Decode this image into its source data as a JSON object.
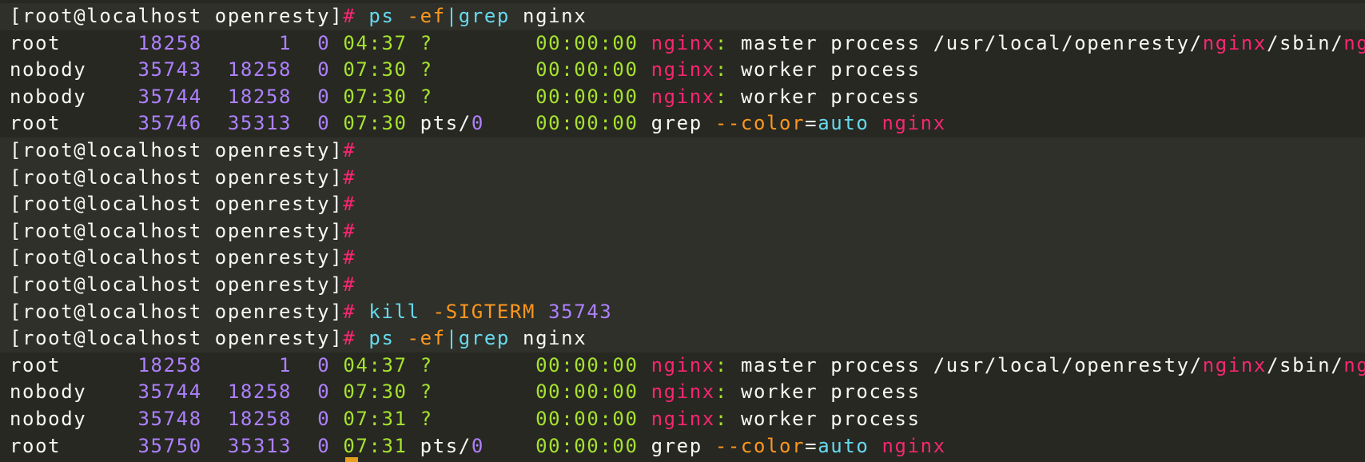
{
  "colors": {
    "background": "#272822",
    "highlight_background": "#2f3029",
    "default": "#f8f8f2",
    "prompt_hash": "#f92672",
    "command": "#66d9ef",
    "option": "#fd971f",
    "number": "#ae81ff",
    "time": "#a6e22e",
    "keyword": "#f92672",
    "value": "#66d9ef"
  },
  "terminal": {
    "lines": [
      {
        "hl": true,
        "segs": [
          {
            "t": "[root@localhost openresty]",
            "c": "default"
          },
          {
            "t": "# ",
            "c": "prompt_hash"
          },
          {
            "t": "ps ",
            "c": "command"
          },
          {
            "t": "-ef",
            "c": "option"
          },
          {
            "t": "|",
            "c": "command"
          },
          {
            "t": "grep ",
            "c": "command"
          },
          {
            "t": "nginx",
            "c": "default"
          }
        ]
      },
      {
        "hl": false,
        "segs": [
          {
            "t": "root      ",
            "c": "default"
          },
          {
            "t": "18258",
            "c": "number"
          },
          {
            "t": "      ",
            "c": "default"
          },
          {
            "t": "1",
            "c": "number"
          },
          {
            "t": "  ",
            "c": "default"
          },
          {
            "t": "0",
            "c": "number"
          },
          {
            "t": " ",
            "c": "default"
          },
          {
            "t": "04:37",
            "c": "time"
          },
          {
            "t": " ",
            "c": "default"
          },
          {
            "t": "?",
            "c": "time"
          },
          {
            "t": "        ",
            "c": "default"
          },
          {
            "t": "00:00:00",
            "c": "time"
          },
          {
            "t": " ",
            "c": "default"
          },
          {
            "t": "nginx",
            "c": "keyword"
          },
          {
            "t": ":",
            "c": "time"
          },
          {
            "t": " master process /usr/local/openresty/",
            "c": "default"
          },
          {
            "t": "nginx",
            "c": "keyword"
          },
          {
            "t": "/sbin/",
            "c": "default"
          },
          {
            "t": "nginx",
            "c": "keyword"
          }
        ]
      },
      {
        "hl": false,
        "segs": [
          {
            "t": "nobody    ",
            "c": "default"
          },
          {
            "t": "35743",
            "c": "number"
          },
          {
            "t": "  ",
            "c": "default"
          },
          {
            "t": "18258",
            "c": "number"
          },
          {
            "t": "  ",
            "c": "default"
          },
          {
            "t": "0",
            "c": "number"
          },
          {
            "t": " ",
            "c": "default"
          },
          {
            "t": "07:30",
            "c": "time"
          },
          {
            "t": " ",
            "c": "default"
          },
          {
            "t": "?",
            "c": "time"
          },
          {
            "t": "        ",
            "c": "default"
          },
          {
            "t": "00:00:00",
            "c": "time"
          },
          {
            "t": " ",
            "c": "default"
          },
          {
            "t": "nginx",
            "c": "keyword"
          },
          {
            "t": ":",
            "c": "time"
          },
          {
            "t": " worker process",
            "c": "default"
          }
        ]
      },
      {
        "hl": false,
        "segs": [
          {
            "t": "nobody    ",
            "c": "default"
          },
          {
            "t": "35744",
            "c": "number"
          },
          {
            "t": "  ",
            "c": "default"
          },
          {
            "t": "18258",
            "c": "number"
          },
          {
            "t": "  ",
            "c": "default"
          },
          {
            "t": "0",
            "c": "number"
          },
          {
            "t": " ",
            "c": "default"
          },
          {
            "t": "07:30",
            "c": "time"
          },
          {
            "t": " ",
            "c": "default"
          },
          {
            "t": "?",
            "c": "time"
          },
          {
            "t": "        ",
            "c": "default"
          },
          {
            "t": "00:00:00",
            "c": "time"
          },
          {
            "t": " ",
            "c": "default"
          },
          {
            "t": "nginx",
            "c": "keyword"
          },
          {
            "t": ":",
            "c": "time"
          },
          {
            "t": " worker process",
            "c": "default"
          }
        ]
      },
      {
        "hl": false,
        "segs": [
          {
            "t": "root      ",
            "c": "default"
          },
          {
            "t": "35746",
            "c": "number"
          },
          {
            "t": "  ",
            "c": "default"
          },
          {
            "t": "35313",
            "c": "number"
          },
          {
            "t": "  ",
            "c": "default"
          },
          {
            "t": "0",
            "c": "number"
          },
          {
            "t": " ",
            "c": "default"
          },
          {
            "t": "07:30",
            "c": "time"
          },
          {
            "t": " pts/",
            "c": "default"
          },
          {
            "t": "0",
            "c": "number"
          },
          {
            "t": "    ",
            "c": "default"
          },
          {
            "t": "00:00:00",
            "c": "time"
          },
          {
            "t": " grep ",
            "c": "default"
          },
          {
            "t": "--color",
            "c": "option"
          },
          {
            "t": "=",
            "c": "default"
          },
          {
            "t": "auto",
            "c": "value"
          },
          {
            "t": " ",
            "c": "default"
          },
          {
            "t": "nginx",
            "c": "keyword"
          }
        ]
      },
      {
        "hl": true,
        "segs": [
          {
            "t": "[root@localhost openresty]",
            "c": "default"
          },
          {
            "t": "#",
            "c": "prompt_hash"
          }
        ]
      },
      {
        "hl": true,
        "segs": [
          {
            "t": "[root@localhost openresty]",
            "c": "default"
          },
          {
            "t": "#",
            "c": "prompt_hash"
          }
        ]
      },
      {
        "hl": true,
        "segs": [
          {
            "t": "[root@localhost openresty]",
            "c": "default"
          },
          {
            "t": "#",
            "c": "prompt_hash"
          }
        ]
      },
      {
        "hl": true,
        "segs": [
          {
            "t": "[root@localhost openresty]",
            "c": "default"
          },
          {
            "t": "#",
            "c": "prompt_hash"
          }
        ]
      },
      {
        "hl": true,
        "segs": [
          {
            "t": "[root@localhost openresty]",
            "c": "default"
          },
          {
            "t": "#",
            "c": "prompt_hash"
          }
        ]
      },
      {
        "hl": true,
        "segs": [
          {
            "t": "[root@localhost openresty]",
            "c": "default"
          },
          {
            "t": "#",
            "c": "prompt_hash"
          }
        ]
      },
      {
        "hl": true,
        "segs": [
          {
            "t": "[root@localhost openresty]",
            "c": "default"
          },
          {
            "t": "# ",
            "c": "prompt_hash"
          },
          {
            "t": "kill ",
            "c": "command"
          },
          {
            "t": "-SIGTERM",
            "c": "option"
          },
          {
            "t": " ",
            "c": "default"
          },
          {
            "t": "35743",
            "c": "number"
          }
        ]
      },
      {
        "hl": true,
        "segs": [
          {
            "t": "[root@localhost openresty]",
            "c": "default"
          },
          {
            "t": "# ",
            "c": "prompt_hash"
          },
          {
            "t": "ps ",
            "c": "command"
          },
          {
            "t": "-ef",
            "c": "option"
          },
          {
            "t": "|",
            "c": "command"
          },
          {
            "t": "grep ",
            "c": "command"
          },
          {
            "t": "nginx",
            "c": "default"
          }
        ]
      },
      {
        "hl": false,
        "segs": [
          {
            "t": "root      ",
            "c": "default"
          },
          {
            "t": "18258",
            "c": "number"
          },
          {
            "t": "      ",
            "c": "default"
          },
          {
            "t": "1",
            "c": "number"
          },
          {
            "t": "  ",
            "c": "default"
          },
          {
            "t": "0",
            "c": "number"
          },
          {
            "t": " ",
            "c": "default"
          },
          {
            "t": "04:37",
            "c": "time"
          },
          {
            "t": " ",
            "c": "default"
          },
          {
            "t": "?",
            "c": "time"
          },
          {
            "t": "        ",
            "c": "default"
          },
          {
            "t": "00:00:00",
            "c": "time"
          },
          {
            "t": " ",
            "c": "default"
          },
          {
            "t": "nginx",
            "c": "keyword"
          },
          {
            "t": ":",
            "c": "time"
          },
          {
            "t": " master process /usr/local/openresty/",
            "c": "default"
          },
          {
            "t": "nginx",
            "c": "keyword"
          },
          {
            "t": "/sbin/",
            "c": "default"
          },
          {
            "t": "nginx",
            "c": "keyword"
          }
        ]
      },
      {
        "hl": false,
        "segs": [
          {
            "t": "nobody    ",
            "c": "default"
          },
          {
            "t": "35744",
            "c": "number"
          },
          {
            "t": "  ",
            "c": "default"
          },
          {
            "t": "18258",
            "c": "number"
          },
          {
            "t": "  ",
            "c": "default"
          },
          {
            "t": "0",
            "c": "number"
          },
          {
            "t": " ",
            "c": "default"
          },
          {
            "t": "07:30",
            "c": "time"
          },
          {
            "t": " ",
            "c": "default"
          },
          {
            "t": "?",
            "c": "time"
          },
          {
            "t": "        ",
            "c": "default"
          },
          {
            "t": "00:00:00",
            "c": "time"
          },
          {
            "t": " ",
            "c": "default"
          },
          {
            "t": "nginx",
            "c": "keyword"
          },
          {
            "t": ":",
            "c": "time"
          },
          {
            "t": " worker process",
            "c": "default"
          }
        ]
      },
      {
        "hl": false,
        "segs": [
          {
            "t": "nobody    ",
            "c": "default"
          },
          {
            "t": "35748",
            "c": "number"
          },
          {
            "t": "  ",
            "c": "default"
          },
          {
            "t": "18258",
            "c": "number"
          },
          {
            "t": "  ",
            "c": "default"
          },
          {
            "t": "0",
            "c": "number"
          },
          {
            "t": " ",
            "c": "default"
          },
          {
            "t": "07:31",
            "c": "time"
          },
          {
            "t": " ",
            "c": "default"
          },
          {
            "t": "?",
            "c": "time"
          },
          {
            "t": "        ",
            "c": "default"
          },
          {
            "t": "00:00:00",
            "c": "time"
          },
          {
            "t": " ",
            "c": "default"
          },
          {
            "t": "nginx",
            "c": "keyword"
          },
          {
            "t": ":",
            "c": "time"
          },
          {
            "t": " worker process",
            "c": "default"
          }
        ]
      },
      {
        "hl": false,
        "segs": [
          {
            "t": "root      ",
            "c": "default"
          },
          {
            "t": "35750",
            "c": "number"
          },
          {
            "t": "  ",
            "c": "default"
          },
          {
            "t": "35313",
            "c": "number"
          },
          {
            "t": "  ",
            "c": "default"
          },
          {
            "t": "0",
            "c": "number"
          },
          {
            "t": " ",
            "c": "default"
          },
          {
            "t": "07:31",
            "c": "time"
          },
          {
            "t": " pts/",
            "c": "default"
          },
          {
            "t": "0",
            "c": "number"
          },
          {
            "t": "    ",
            "c": "default"
          },
          {
            "t": "00:00:00",
            "c": "time"
          },
          {
            "t": " grep ",
            "c": "default"
          },
          {
            "t": "--color",
            "c": "option"
          },
          {
            "t": "=",
            "c": "default"
          },
          {
            "t": "auto",
            "c": "value"
          },
          {
            "t": " ",
            "c": "default"
          },
          {
            "t": "nginx",
            "c": "keyword"
          }
        ]
      }
    ]
  }
}
